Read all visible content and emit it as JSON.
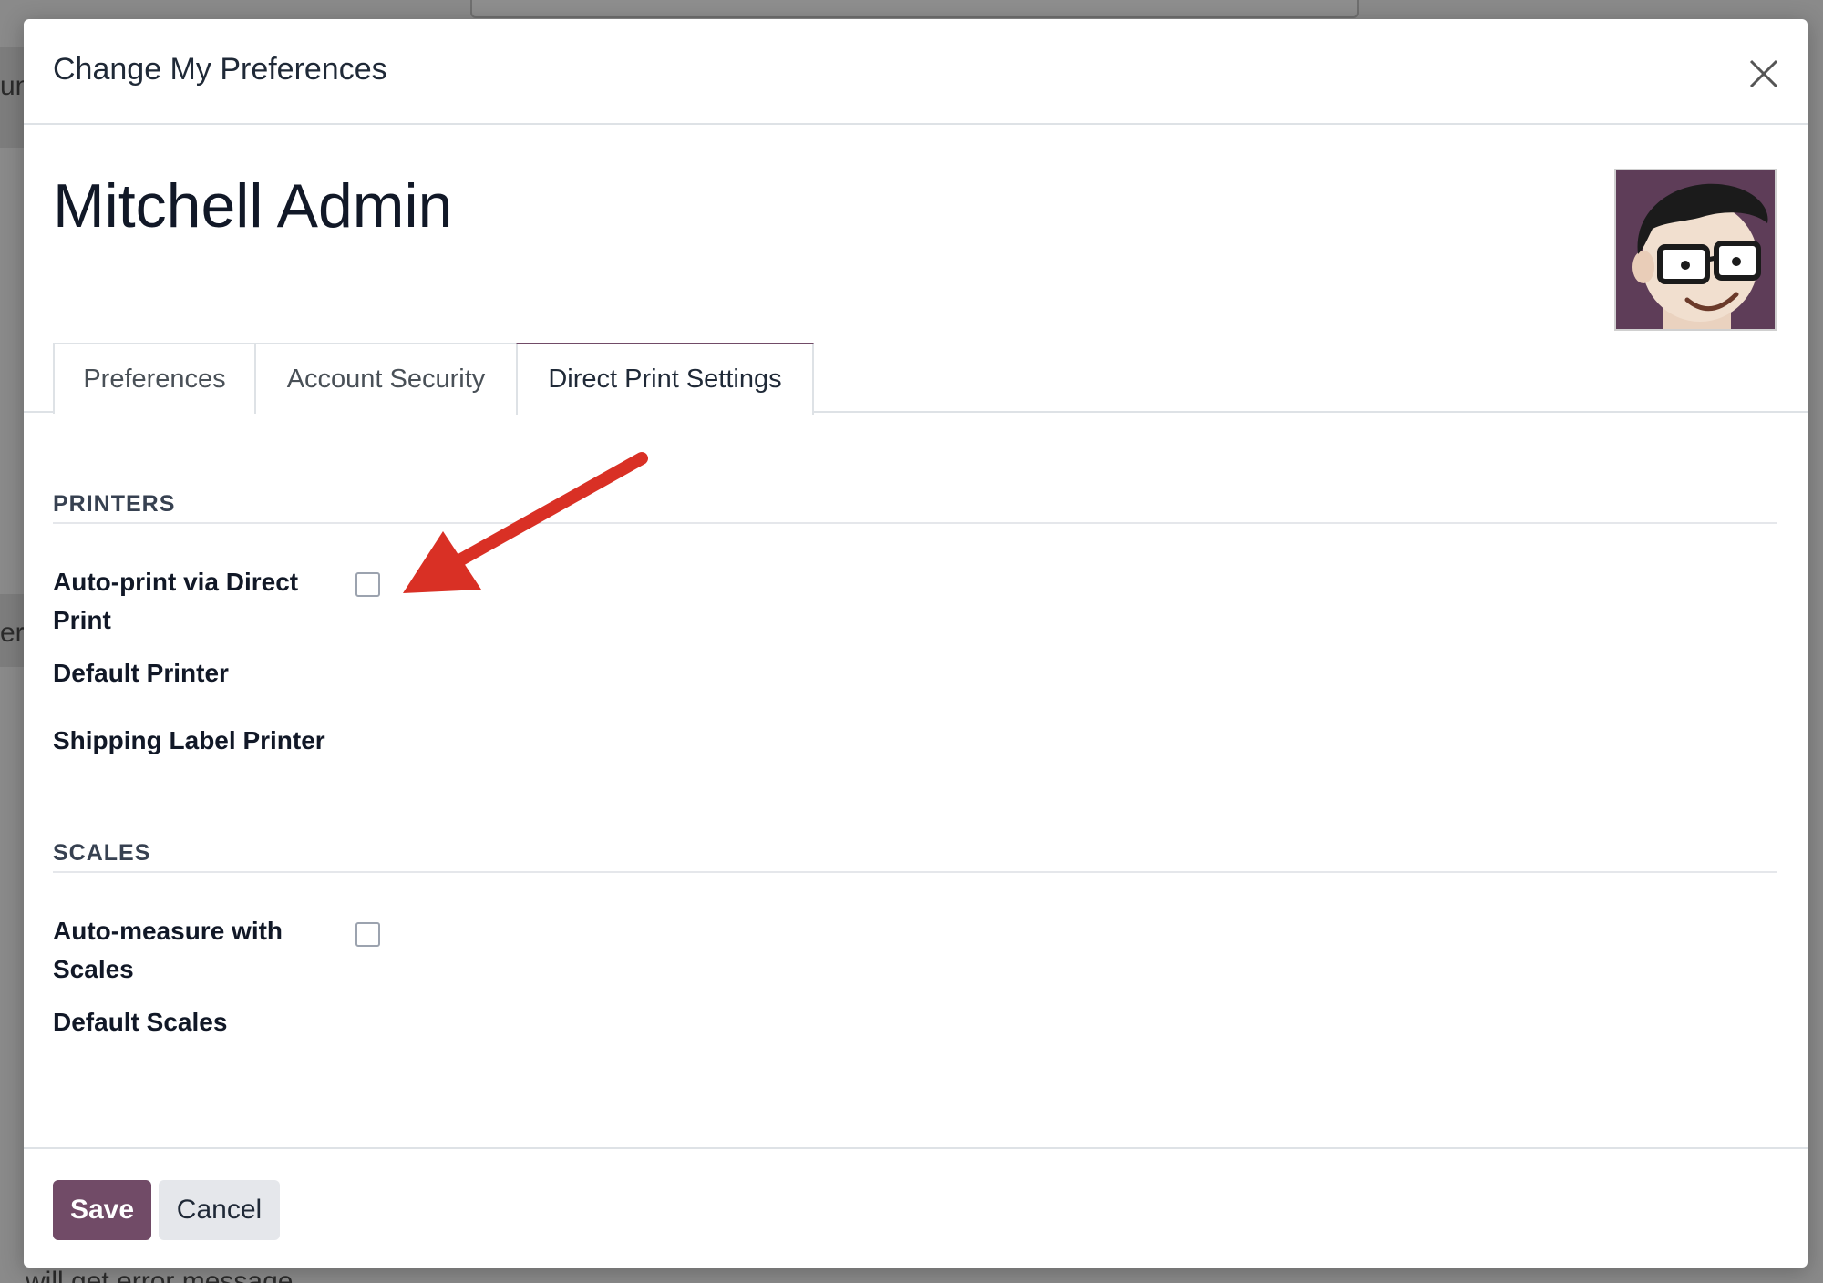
{
  "background": {
    "left_text_1": "un",
    "left_text_2": "er :",
    "bottom_text": "will get error message"
  },
  "modal": {
    "title": "Change My Preferences",
    "close_icon": "close-icon"
  },
  "user": {
    "name": "Mitchell Admin",
    "avatar_icon": "avatar-cartoon"
  },
  "tabs": [
    {
      "label": "Preferences",
      "active": false
    },
    {
      "label": "Account Security",
      "active": false
    },
    {
      "label": "Direct Print Settings",
      "active": true
    }
  ],
  "printers": {
    "section_title": "PRINTERS",
    "auto_print_label": "Auto-print via Direct Print",
    "auto_print_checked": false,
    "default_printer_label": "Default Printer",
    "shipping_label_printer_label": "Shipping Label Printer"
  },
  "scales": {
    "section_title": "SCALES",
    "auto_measure_label": "Auto-measure with Scales",
    "auto_measure_checked": false,
    "default_scales_label": "Default Scales"
  },
  "footer": {
    "save_label": "Save",
    "cancel_label": "Cancel"
  },
  "colors": {
    "brand": "#714b67",
    "annotation_arrow": "#d93025"
  }
}
